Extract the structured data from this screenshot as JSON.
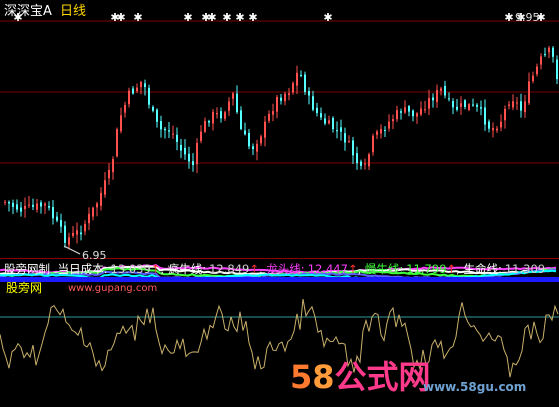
{
  "header": {
    "title": "深深宝A",
    "period": "日线"
  },
  "price_labels": {
    "low": "6.95",
    "high": "9.95"
  },
  "indicator": {
    "name": "股旁网制",
    "items": [
      {
        "label": "当日成本:",
        "value": "13.039",
        "arrow": "↑",
        "label_color": "#ffffff",
        "value_color": "#d0d0d0"
      },
      {
        "label": "疯牛线:",
        "value": "12.849",
        "arrow": "↑",
        "label_color": "#ffffff",
        "value_color": "#d0d0d0"
      },
      {
        "label": "龙头线:",
        "value": "12.447",
        "arrow": "↑",
        "label_color": "#ff40ff",
        "value_color": "#ff40ff"
      },
      {
        "label": "慢牛线:",
        "value": "11.799",
        "arrow": "↑",
        "label_color": "#40ff40",
        "value_color": "#40ff40"
      },
      {
        "label": "生命线:",
        "value": "11.309",
        "arrow": "",
        "label_color": "#ffffff",
        "value_color": "#d0d0d0"
      }
    ]
  },
  "sub_labels": {
    "brand": "股旁网",
    "site": "www.gupang.com"
  },
  "watermark": {
    "num5": "5",
    "num8": "8",
    "text": "公式网",
    "site": "www.58gu.com"
  },
  "colors": {
    "up": "#ff5050",
    "down": "#55ffff",
    "grid": "#8b0000",
    "arrow": "#ff3030",
    "star": "#ffffff"
  }
}
